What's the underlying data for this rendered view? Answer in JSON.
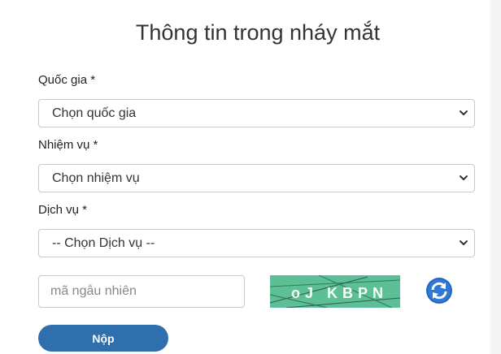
{
  "form": {
    "title": "Thông tin trong nháy mắt",
    "country": {
      "label": "Quốc gia *",
      "value": "Chọn quốc gia"
    },
    "mission": {
      "label": "Nhiệm vụ *",
      "value": "Chọn nhiệm vụ"
    },
    "service": {
      "label": "Dịch vụ *",
      "value": "-- Chọn Dịch vụ --"
    },
    "captcha": {
      "placeholder": "mã ngẫu nhiên",
      "text": "oJ KBPN"
    },
    "submit_label": "Nộp"
  },
  "colors": {
    "button": "#2f6fae",
    "captcha_bg": "#5cbf95",
    "refresh": "#2f78d4"
  },
  "icons": [
    "chevron-down-icon",
    "refresh-icon"
  ]
}
